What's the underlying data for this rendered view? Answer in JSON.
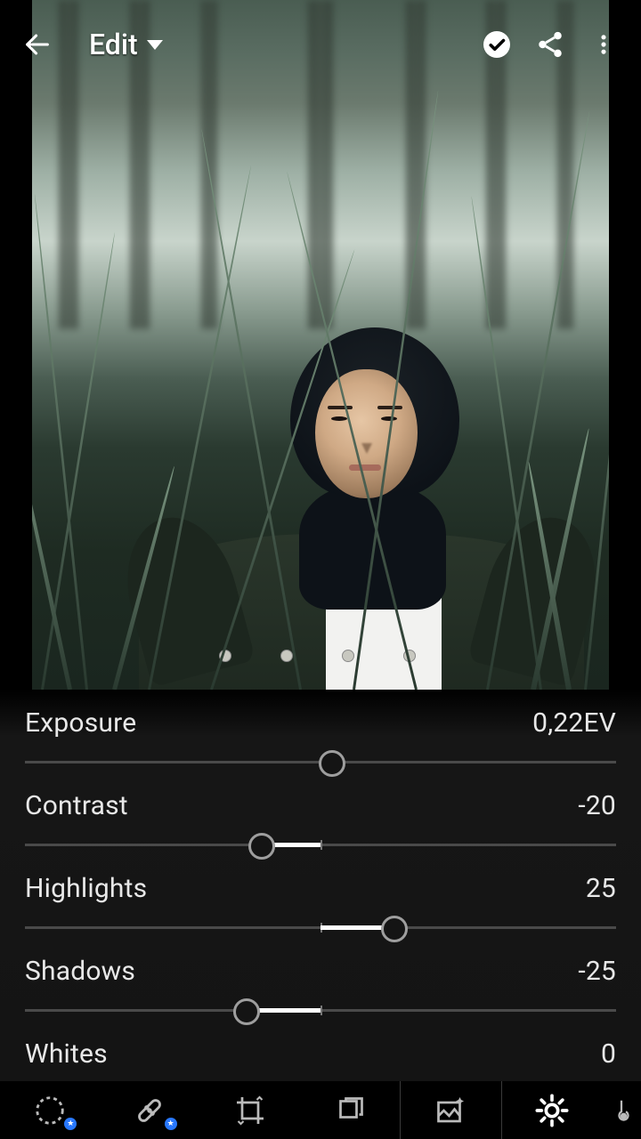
{
  "header": {
    "title": "Edit"
  },
  "sliders": [
    {
      "label": "Exposure",
      "value_text": "0,22EV",
      "pos": 52.0,
      "fill_from": 50,
      "fill_to": 50
    },
    {
      "label": "Contrast",
      "value_text": "-20",
      "pos": 40.0,
      "fill_from": 40,
      "fill_to": 50
    },
    {
      "label": "Highlights",
      "value_text": "25",
      "pos": 62.5,
      "fill_from": 50,
      "fill_to": 62.5
    },
    {
      "label": "Shadows",
      "value_text": "-25",
      "pos": 37.5,
      "fill_from": 37.5,
      "fill_to": 50
    },
    {
      "label": "Whites",
      "value_text": "0",
      "pos": 50.0,
      "fill_from": 50,
      "fill_to": 50
    }
  ],
  "toolbar": {
    "active_index": 5
  }
}
